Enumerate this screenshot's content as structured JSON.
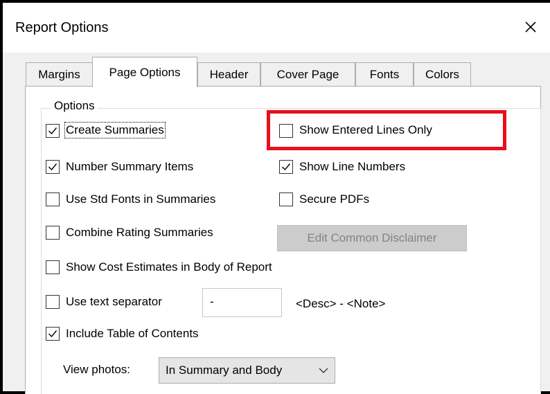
{
  "window": {
    "title": "Report Options",
    "close_icon": "close-icon"
  },
  "tabs": [
    {
      "label": "Margins",
      "active": false
    },
    {
      "label": "Page Options",
      "active": true
    },
    {
      "label": "Header",
      "active": false
    },
    {
      "label": "Cover Page",
      "active": false
    },
    {
      "label": "Fonts",
      "active": false
    },
    {
      "label": "Colors",
      "active": false
    }
  ],
  "options": {
    "group_label": "Options",
    "create_summaries": {
      "label": "Create Summaries",
      "checked": true
    },
    "number_summary_items": {
      "label": "Number Summary Items",
      "checked": true
    },
    "use_std_fonts": {
      "label": "Use Std Fonts in Summaries",
      "checked": false
    },
    "combine_rating": {
      "label": "Combine Rating Summaries",
      "checked": false
    },
    "show_entered_lines": {
      "label": "Show Entered Lines Only",
      "checked": false
    },
    "show_line_numbers": {
      "label": "Show Line Numbers",
      "checked": true
    },
    "secure_pdfs": {
      "label": "Secure PDFs",
      "checked": false
    },
    "edit_disclaimer_label": "Edit Common Disclaimer",
    "show_cost_estimates": {
      "label": "Show Cost Estimates in Body of Report",
      "checked": false
    },
    "use_text_separator": {
      "label": "Use text separator",
      "checked": false
    },
    "separator_value": "-",
    "separator_preview": "<Desc> - <Note>",
    "include_toc": {
      "label": "Include Table of Contents",
      "checked": true
    },
    "view_photos_label": "View photos:",
    "view_photos_value": "In Summary and Body"
  },
  "highlight_color": "#e8101b"
}
